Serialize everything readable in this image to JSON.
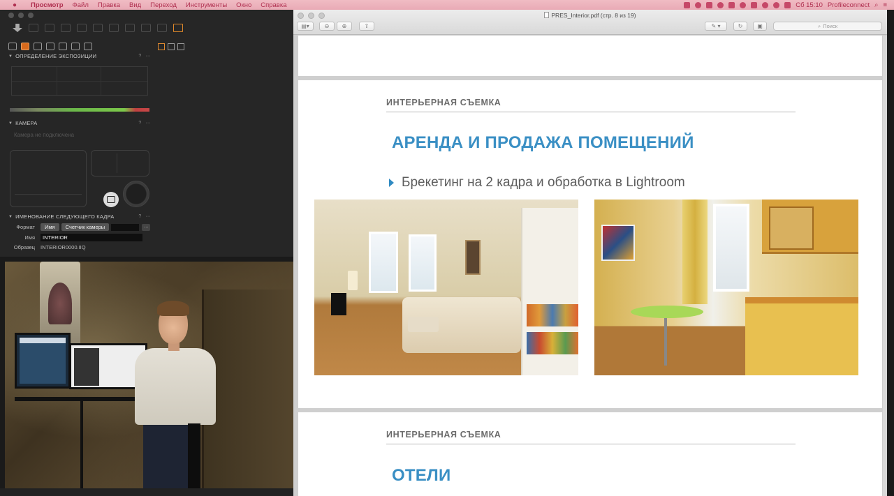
{
  "menubar": {
    "app": "Просмотр",
    "items": [
      "Файл",
      "Правка",
      "Вид",
      "Переход",
      "Инструменты",
      "Окно",
      "Справка"
    ],
    "clock": "Сб 15:10",
    "user": "Profileconnect"
  },
  "capture": {
    "exposure_title": "ОПРЕДЕЛЕНИЕ ЭКСПОЗИЦИИ",
    "camera_title": "КАМЕРА",
    "camera_status": "Камера не подключена",
    "naming_title": "ИМЕНОВАНИЕ СЛЕДУЮЩЕГО КАДРА",
    "format_label": "Формат",
    "format_tokens": [
      "Имя",
      "Счетчик камеры"
    ],
    "name_label": "Имя",
    "name_value": "INTERIOR",
    "sample_label": "Образец",
    "sample_value": "INTERIOR0000.IIQ",
    "help": "?",
    "more": "···"
  },
  "preview": {
    "title": "PRES_Interior.pdf (стр. 8 из 19)",
    "search_placeholder": "Поиск",
    "page_main": {
      "kicker": "ИНТЕРЬЕРНАЯ СЪЕМКА",
      "title": "АРЕНДА И ПРОДАЖА ПОМЕЩЕНИЙ",
      "bullet": "Брекетинг на 2 кадра и обработка в Lightroom"
    },
    "page_next": {
      "kicker": "ИНТЕРЬЕРНАЯ СЪЕМКА",
      "title": "ОТЕЛИ"
    }
  },
  "icons": {
    "menubar": [
      "apple-icon",
      "wifi-icon",
      "battery-icon",
      "search-icon",
      "list-icon"
    ],
    "capture_toolbar": [
      "import-icon",
      "capture-icon",
      "rotate-left-icon",
      "rotate-right-icon",
      "trash-icon",
      "undo-icon",
      "redo-icon",
      "copy-icon"
    ],
    "tool_tabs": [
      "folder-tab-icon",
      "camera-tab-icon",
      "color-tab-icon",
      "search-tab-icon",
      "crop-tab-icon",
      "settings-tab-icon",
      "metadata-tab-icon"
    ]
  },
  "colors": {
    "accent_blue": "#3a8fc4",
    "capture_orange": "#d86a1c",
    "menubar_pink": "#eeb4bf"
  }
}
